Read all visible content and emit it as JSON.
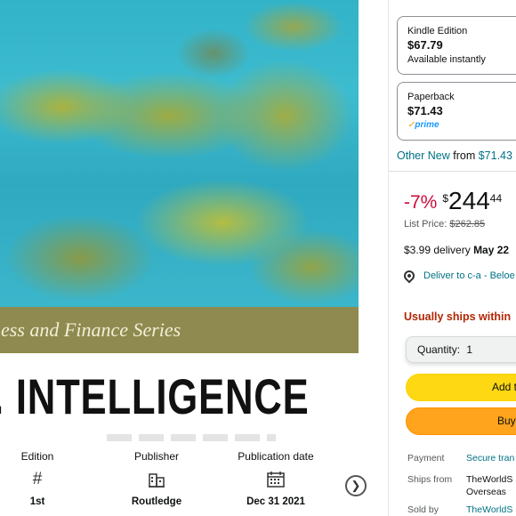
{
  "cover": {
    "series_text": "ness and Finance Series",
    "title_text": ". INTELLIGENCE"
  },
  "details": [
    {
      "label": "Edition",
      "icon": "hash-icon",
      "glyph": "#",
      "value": "1st"
    },
    {
      "label": "Publisher",
      "icon": "building-icon",
      "glyph": "🏢",
      "value": "Routledge"
    },
    {
      "label": "Publication date",
      "icon": "calendar-icon",
      "glyph": "📅",
      "value": "Dec 31 2021"
    }
  ],
  "formats": [
    {
      "name": "Kindle Edition",
      "price": "$67.79",
      "note": "Available instantly"
    },
    {
      "name": "Paperback",
      "price": "$71.43",
      "note": "prime"
    }
  ],
  "other_new": {
    "link": "Other New",
    "from": "from",
    "price": "$71.43"
  },
  "buybox": {
    "discount": "-7%",
    "currency": "$",
    "whole": "244",
    "fraction": "44",
    "list_price_label": "List Price:",
    "list_price": "$262.85",
    "delivery_prefix": "$3.99 delivery",
    "delivery_date": "May 22",
    "deliver_to": "Deliver to c-a - Beloe",
    "availability": "Usually ships within",
    "quantity_label": "Quantity:",
    "quantity_value": "1",
    "add_to_cart": "Add t",
    "buy_now": "Buy"
  },
  "info_rows": [
    {
      "key": "Payment",
      "value": "Secure tran",
      "link": true
    },
    {
      "key": "Ships from",
      "value": "TheWorldS",
      "value2": "Overseas",
      "link": false
    },
    {
      "key": "Sold by",
      "value": "TheWorldS",
      "link": true
    }
  ],
  "colors": {
    "accent_link": "#007185",
    "deal_red": "#cc0c39",
    "availability": "#b12704",
    "cart_yellow": "#ffd814",
    "buy_orange": "#ffa41c"
  }
}
